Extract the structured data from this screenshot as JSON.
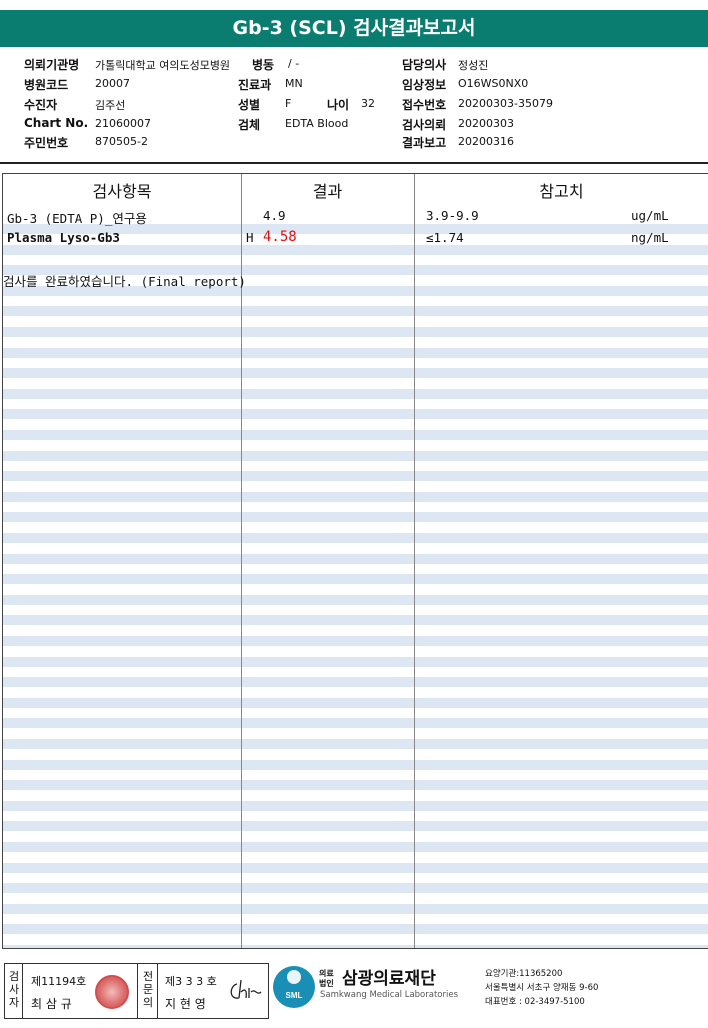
{
  "title": "Gb-3 (SCL) 검사결과보고서",
  "header": {
    "institution_label": "의뢰기관명",
    "institution_value": "가톨릭대학교 여의도성모병원",
    "ward_label": "병동",
    "ward_value": "/ -",
    "doctor_label": "담당의사",
    "doctor_value": "정성진",
    "hospital_code_label": "병원코드",
    "hospital_code_value": "20007",
    "department_label": "진료과",
    "department_value": "MN",
    "clinical_info_label": "임상정보",
    "clinical_info_value": "O16WS0NX0",
    "patient_label": "수진자",
    "patient_value": "김주선",
    "sex_label": "성별",
    "sex_value": "F",
    "age_label": "나이",
    "age_value": "32",
    "reception_label": "접수번호",
    "reception_value": "20200303-35079",
    "chart_label": "Chart No.",
    "chart_value": "21060007",
    "specimen_label": "검체",
    "specimen_value": "EDTA Blood",
    "request_label": "검사의뢰",
    "request_value": "20200303",
    "id_label": "주민번호",
    "id_value": "870505-2",
    "report_label": "결과보고",
    "report_value": "20200316"
  },
  "table": {
    "col_item": "검사항목",
    "col_result": "결과",
    "col_reference": "참고치",
    "rows": [
      {
        "item": "Gb-3 (EDTA P)_연구용",
        "flag": "",
        "result": "4.9",
        "reference": "3.9-9.9",
        "unit": "ug/mL"
      },
      {
        "item": "Plasma Lyso-Gb3",
        "flag": "H",
        "result": "4.58",
        "reference": "≤1.74",
        "unit": "ng/mL"
      }
    ],
    "final_note": "검사를  완료하였습니다. (Final report)"
  },
  "footer": {
    "examiner_label": "검사자",
    "examiner_no": "제11194호",
    "examiner_name": "최 삼 규",
    "doctor_label": "전문의",
    "doctor_no": "제3 3 3 호",
    "doctor_name": "지 현 영",
    "corp_small": "의료법인",
    "corp_name": "삼광의료재단",
    "corp_english": "Samkwang Medical Laboratories",
    "corp_code": "요양기관:11365200",
    "corp_address": "서울특별시 서초구 양재동 9-60",
    "corp_phone": "대표번호 : 02-3497-5100",
    "logo_text": "SML"
  },
  "colors": {
    "title_bar": "#0b7d70",
    "stripe": "#dde6f3",
    "high_flag": "#e01010"
  }
}
